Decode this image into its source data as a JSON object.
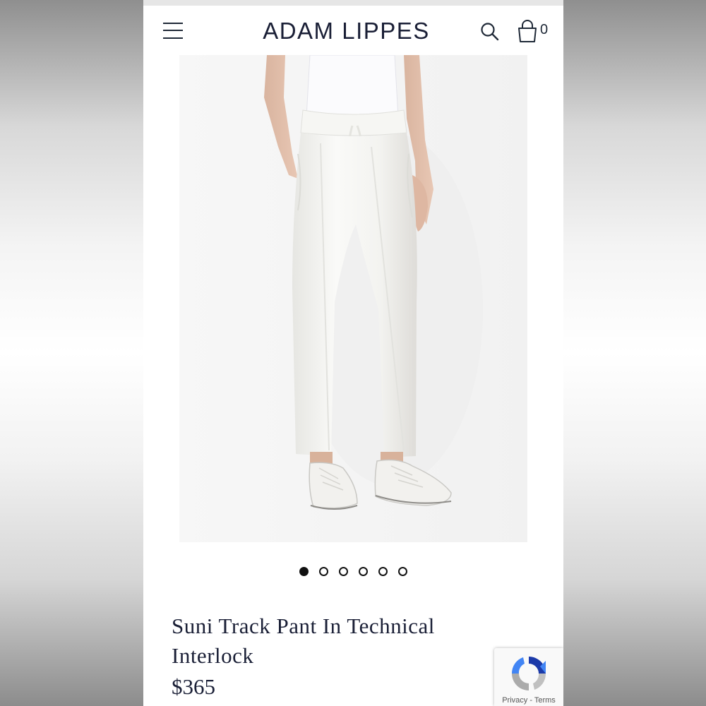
{
  "header": {
    "brand": "ADAM LIPPES",
    "cart_count": "0",
    "icons": {
      "menu": "hamburger-menu-icon",
      "search": "search-icon",
      "cart": "shopping-bag-icon"
    }
  },
  "product": {
    "title": "Suni Track Pant In Technical Interlock",
    "price": "$365",
    "image": "white-track-pants-model-photo"
  },
  "carousel": {
    "count": 6,
    "active_index": 0
  },
  "recaptcha": {
    "privacy": "Privacy",
    "separator": " - ",
    "terms": "Terms",
    "icon": "recaptcha-logo-icon"
  },
  "colors": {
    "brand_text": "#1a1f36",
    "background": "#ffffff"
  }
}
